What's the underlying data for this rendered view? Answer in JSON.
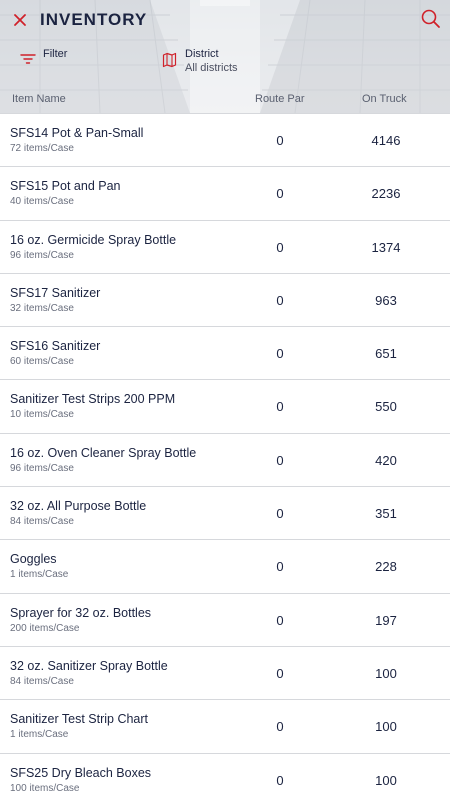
{
  "header": {
    "title": "INVENTORY",
    "filter_label": "Filter",
    "district_label": "District",
    "district_value": "All districts"
  },
  "columns": {
    "item_name": "Item Name",
    "route_par": "Route Par",
    "on_truck": "On Truck"
  },
  "colors": {
    "accent": "#d0212a",
    "text": "#1b2340",
    "divider": "#d6d8dc"
  },
  "icons": {
    "close": "close-icon",
    "search": "search-icon",
    "filter": "filter-icon",
    "district": "map-icon"
  },
  "items": [
    {
      "name": "SFS14 Pot & Pan-Small",
      "case": "72 items/Case",
      "route_par": "0",
      "on_truck": "4146"
    },
    {
      "name": "SFS15 Pot and Pan",
      "case": "40 items/Case",
      "route_par": "0",
      "on_truck": "2236"
    },
    {
      "name": "16 oz. Germicide Spray Bottle",
      "case": "96 items/Case",
      "route_par": "0",
      "on_truck": "1374"
    },
    {
      "name": "SFS17 Sanitizer",
      "case": "32 items/Case",
      "route_par": "0",
      "on_truck": "963"
    },
    {
      "name": "SFS16 Sanitizer",
      "case": "60 items/Case",
      "route_par": "0",
      "on_truck": "651"
    },
    {
      "name": "Sanitizer Test Strips 200 PPM",
      "case": "10 items/Case",
      "route_par": "0",
      "on_truck": "550"
    },
    {
      "name": "16 oz. Oven Cleaner Spray Bottle",
      "case": "96 items/Case",
      "route_par": "0",
      "on_truck": "420"
    },
    {
      "name": "32 oz. All Purpose Bottle",
      "case": "84 items/Case",
      "route_par": "0",
      "on_truck": "351"
    },
    {
      "name": "Goggles",
      "case": "1 items/Case",
      "route_par": "0",
      "on_truck": "228"
    },
    {
      "name": "Sprayer for 32 oz. Bottles",
      "case": "200 items/Case",
      "route_par": "0",
      "on_truck": "197"
    },
    {
      "name": "32 oz. Sanitizer Spray Bottle",
      "case": "84 items/Case",
      "route_par": "0",
      "on_truck": "100"
    },
    {
      "name": "Sanitizer Test Strip Chart",
      "case": "1 items/Case",
      "route_par": "0",
      "on_truck": "100"
    },
    {
      "name": "SFS25 Dry Bleach Boxes",
      "case": "100 items/Case",
      "route_par": "0",
      "on_truck": "100"
    }
  ]
}
